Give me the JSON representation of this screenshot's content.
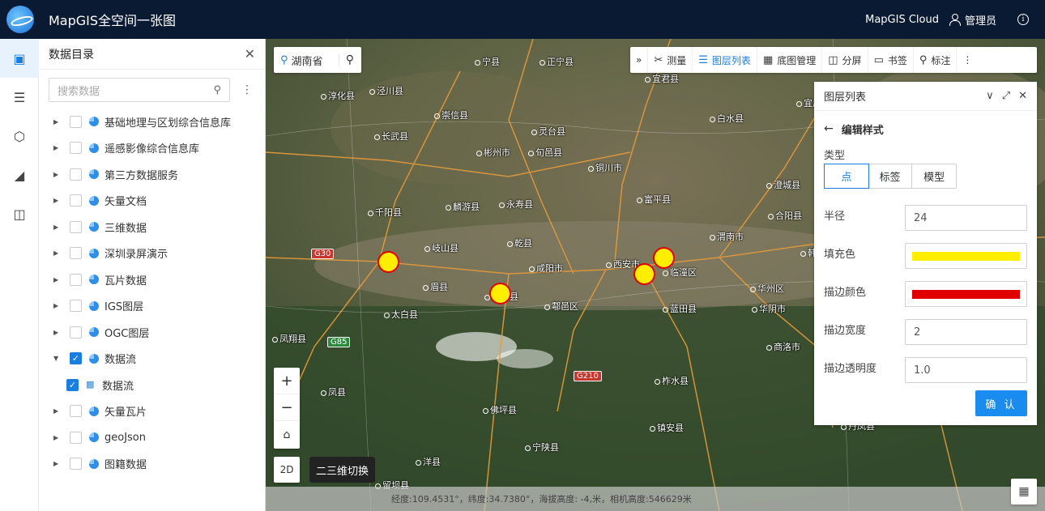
{
  "app": {
    "title": "MapGIS全空间一张图",
    "cloud_label": "MapGIS Cloud",
    "user_label": "管理员"
  },
  "sidebar": {
    "icons": [
      "cube-icon",
      "list-icon",
      "cube-outline-icon",
      "k-icon",
      "monitor-icon"
    ]
  },
  "catalog": {
    "title": "数据目录",
    "search_placeholder": "搜索数据",
    "items": [
      {
        "label": "基础地理与区划综合信息库",
        "checked": false
      },
      {
        "label": "遥感影像综合信息库",
        "checked": false
      },
      {
        "label": "第三方数据服务",
        "checked": false
      },
      {
        "label": "矢量文档",
        "checked": false
      },
      {
        "label": "三维数据",
        "checked": false
      },
      {
        "label": "深圳录屏演示",
        "checked": false
      },
      {
        "label": "瓦片数据",
        "checked": false
      },
      {
        "label": "IGS图层",
        "checked": false
      },
      {
        "label": "OGC图层",
        "checked": false
      },
      {
        "label": "数据流",
        "checked": true,
        "expanded": true
      },
      {
        "label": "数据流",
        "checked": true,
        "child": true
      },
      {
        "label": "矢量瓦片",
        "checked": false
      },
      {
        "label": "geoJson",
        "checked": false
      },
      {
        "label": "图籍数据",
        "checked": false
      }
    ]
  },
  "map": {
    "location": "湖南省",
    "toolbar": {
      "measure": "测量",
      "layers": "图层列表",
      "basemap": "底图管理",
      "split": "分屏",
      "bookmark": "书签",
      "annotate": "标注"
    },
    "places": [
      "宁县",
      "正宁县",
      "宜君县",
      "淳化县",
      "泾川县",
      "崇信县",
      "长武县",
      "灵台县",
      "旬邑县",
      "彬州市",
      "铜川市",
      "白水县",
      "澄城县",
      "富平县",
      "麟游县",
      "永寿县",
      "乾县",
      "千阳县",
      "岐山县",
      "咸阳市",
      "西安市",
      "临潼区",
      "渭南市",
      "眉县",
      "周至县",
      "鄠邑区",
      "蓝田县",
      "华州区",
      "太白县",
      "商洛市",
      "柞水县",
      "丹凤县",
      "佛坪县",
      "宁陕县",
      "镇安县",
      "凤县",
      "留坝县",
      "洋县",
      "凤翔县",
      "宜川县",
      "合阳县",
      "韩城",
      "华阴市"
    ],
    "road_labels": [
      "G30",
      "G85",
      "G210"
    ],
    "status": "经度:109.4531°，纬度:34.7380°，海拔高度: -4,米，相机高度:546629米",
    "switch_2d": "2D",
    "tooltip": "二三维切换"
  },
  "layer_panel": {
    "title": "图层列表",
    "subtitle": "编辑样式",
    "type_label": "类型",
    "type_options": [
      "点",
      "标签",
      "模型"
    ],
    "radius_label": "半径",
    "radius_value": "24",
    "fill_label": "填充色",
    "fill_color": "#ffee00",
    "stroke_label": "描边颜色",
    "stroke_color": "#e10000",
    "stroke_width_label": "描边宽度",
    "stroke_width_value": "2",
    "stroke_opacity_label": "描边透明度",
    "stroke_opacity_value": "1.0",
    "confirm_label": "确 认"
  }
}
